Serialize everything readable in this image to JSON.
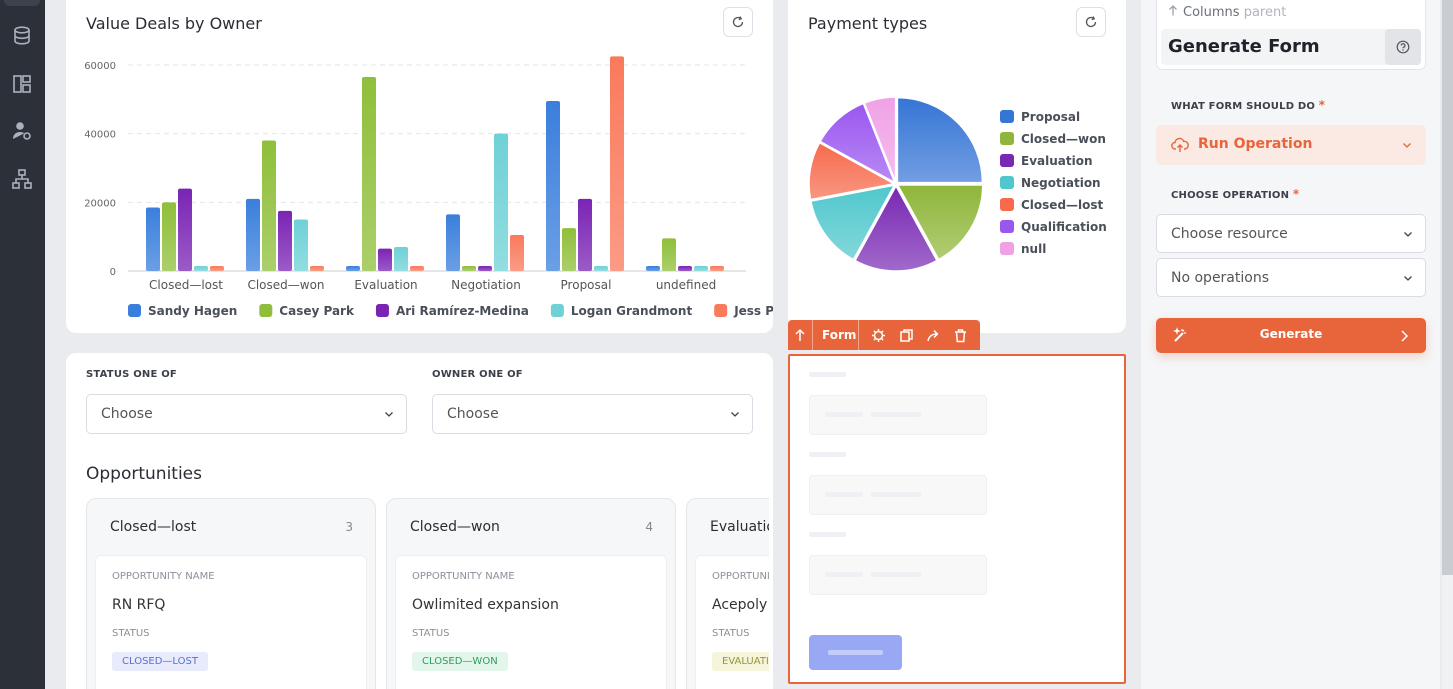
{
  "charts": {
    "bar": {
      "title": "Value Deals by Owner",
      "yticks": [
        "60000",
        "40000",
        "20000",
        "0"
      ]
    },
    "pie": {
      "title": "Payment types"
    }
  },
  "chart_data": [
    {
      "type": "bar",
      "title": "Value Deals by Owner",
      "categories": [
        "Closed—lost",
        "Closed—won",
        "Evaluation",
        "Negotiation",
        "Proposal",
        "undefined"
      ],
      "series": [
        {
          "name": "Sandy Hagen",
          "color": "#3a7fdc",
          "values": [
            18500,
            21000,
            1200,
            16500,
            49500,
            1300
          ]
        },
        {
          "name": "Casey Park",
          "color": "#8fbf3a",
          "values": [
            20000,
            38000,
            56500,
            1200,
            12500,
            9500
          ]
        },
        {
          "name": "Ari Ramírez-Medina",
          "color": "#7a24b4",
          "values": [
            24000,
            17500,
            6500,
            1200,
            21000,
            1200
          ]
        },
        {
          "name": "Logan Grandmont",
          "color": "#6ed1d6",
          "values": [
            1300,
            15000,
            7000,
            40000,
            1300,
            1300
          ]
        },
        {
          "name": "Jess Patel",
          "color": "#fa7a5c",
          "values": [
            1300,
            1300,
            1300,
            10500,
            62500,
            1300
          ]
        }
      ],
      "ylim": [
        0,
        65000
      ],
      "grid": true,
      "legend": "bottom"
    },
    {
      "type": "pie",
      "title": "Payment types",
      "labels": [
        "Proposal",
        "Closed—won",
        "Evaluation",
        "Negotiation",
        "Closed—lost",
        "Qualification",
        "null"
      ],
      "values": [
        25,
        17,
        16,
        14,
        11,
        11,
        6
      ],
      "colors": [
        "#3575d5",
        "#8fb63a",
        "#7828b3",
        "#4fc7cc",
        "#f76a4c",
        "#9a57f0",
        "#f0a1e6"
      ],
      "legend": "right"
    }
  ],
  "filters": {
    "status_label": "STATUS ONE OF",
    "status_value": "Choose",
    "owner_label": "OWNER ONE OF",
    "owner_value": "Choose"
  },
  "opportunities": {
    "title": "Opportunities",
    "columns": [
      {
        "name": "Closed—lost",
        "count": "3",
        "opp_label": "OPPORTUNITY NAME",
        "opp_name": "RN RFQ",
        "status_label": "STATUS",
        "status": "CLOSED—LOST",
        "badge_bg": "#e7ebfb",
        "badge_fg": "#5a6fd0"
      },
      {
        "name": "Closed—won",
        "count": "4",
        "opp_label": "OPPORTUNITY NAME",
        "opp_name": "Owlimited expansion",
        "status_label": "STATUS",
        "status": "CLOSED—WON",
        "badge_bg": "#e3f6ec",
        "badge_fg": "#2f9c5e"
      },
      {
        "name": "Evaluation",
        "count": "",
        "opp_label": "OPPORTUNITY NAME",
        "opp_name": "Acepoly f",
        "status_label": "STATUS",
        "status": "EVALUATION",
        "badge_bg": "#f6f5dc",
        "badge_fg": "#9a9535"
      }
    ]
  },
  "toolbar": {
    "form_label": "Form"
  },
  "right_panel": {
    "parent_link": "Columns",
    "parent_suffix": "parent",
    "title": "Generate Form",
    "what_label": "WHAT FORM SHOULD DO",
    "what_value": "Run Operation",
    "choose_label": "CHOOSE OPERATION",
    "resource_value": "Choose resource",
    "operations_value": "No operations",
    "generate_label": "Generate",
    "required_mark": "*"
  },
  "colors": {
    "accent": "#e8643a",
    "sidebar": "#2c3038"
  }
}
